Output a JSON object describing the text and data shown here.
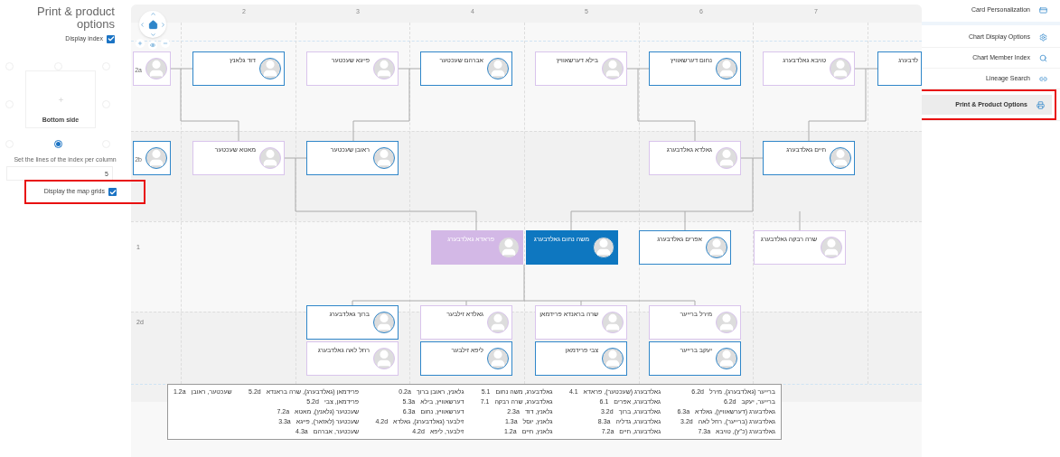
{
  "left_panel": {
    "title": "Print & product options",
    "display_index": {
      "label": "Display index",
      "checked": true
    },
    "positions": [
      {
        "selected": false
      },
      {
        "selected": false
      },
      {
        "selected": false
      },
      {
        "selected": false
      },
      {
        "selected": false
      },
      {
        "selected": false
      },
      {
        "selected": true
      },
      {
        "selected": false
      }
    ],
    "preview": {
      "label": "Bottom side"
    },
    "lines_per_column": {
      "label": "Set the lines of the index per column",
      "value": "5"
    },
    "map_grids": {
      "label": "Display the map grids",
      "checked": true,
      "highlighted": true
    }
  },
  "chart": {
    "column_headers": [
      "7",
      "6",
      "5",
      "4",
      "3",
      "2"
    ],
    "rows": [
      {
        "cards": [
          {
            "name": "לדבערג",
            "color": "#2f86c9",
            "focus": false
          },
          {
            "name": "טויבא גאלדבערג",
            "color": "#d9c4ec",
            "focus": false
          },
          {
            "name": "נחום דערשאוויץ",
            "color": "#2f86c9",
            "focus": false
          },
          {
            "name": "בילא דערשאוויץ",
            "color": "#d9c4ec",
            "focus": false
          },
          {
            "name": "אברהם שעכטער",
            "color": "#2f86c9",
            "focus": false
          },
          {
            "name": "פייגא שעכטער",
            "color": "#d9c4ec",
            "focus": false
          },
          {
            "name": "דוד גלאנץ",
            "color": "#2f86c9",
            "focus": false
          },
          {
            "code": "2a",
            "color": "#d9c4ec",
            "focus": false
          }
        ]
      },
      {
        "cards": [
          {
            "name": "חיים גאלדבערג",
            "color": "#2f86c9",
            "focus": false
          },
          {
            "name": "גאלדא גאלדבערג",
            "color": "#d9c4ec",
            "focus": false
          },
          {
            "name": "ראובן שעכטער",
            "color": "#2f86c9",
            "focus": false
          },
          {
            "name": "מאטא שעכטער",
            "color": "#d9c4ec",
            "focus": false
          },
          {
            "code": "2b",
            "color": "#2f86c9",
            "focus": false
          }
        ]
      },
      {
        "label": "1",
        "cards": [
          {
            "name": "שרה רבקה גאלדבערג",
            "color": "#d9c4ec",
            "focus": false
          },
          {
            "name": "אפרים גאלדבערג",
            "color": "#2f86c9",
            "focus": false
          },
          {
            "name": "משה נחום גאלדבערג",
            "color": "#0e77c0",
            "focus": true
          },
          {
            "name": "פראדא גאלדבערג",
            "color": "#d3b8e6",
            "focus": true
          }
        ]
      },
      {
        "label": "2d",
        "cards": [
          {
            "name": "מירל ברייער",
            "color": "#d9c4ec",
            "focus": false
          },
          {
            "name": "שרה בראנדא פרידמאן",
            "color": "#d9c4ec",
            "focus": false
          },
          {
            "name": "גאלדא זילבער",
            "color": "#d9c4ec",
            "focus": false
          },
          {
            "name": "ברוך גאלדבערג",
            "color": "#2f86c9",
            "focus": false
          }
        ]
      },
      {
        "cards": [
          {
            "name": "יעקב ברייער",
            "color": "#2f86c9",
            "focus": false
          },
          {
            "name": "צבי פרידמאן",
            "color": "#2f86c9",
            "focus": false
          },
          {
            "name": "ליפא זילבער",
            "color": "#2f86c9",
            "focus": false
          },
          {
            "name": "רחל לאה גאלדבערג",
            "color": "#d9c4ec",
            "focus": false
          }
        ]
      }
    ],
    "index": [
      [
        {
          "name": "ברייער (גאלדבערג), מירל",
          "code": "6.2d"
        },
        {
          "name": "ברייער, יעקב",
          "code": "6.2d"
        },
        {
          "name": "גאלדבערג (דערשאוויץ), גאלדא",
          "code": "6.3a"
        },
        {
          "name": "גאלדבערג (ברייער), רחל לאה",
          "code": "3.2d"
        },
        {
          "name": "גאלדבערג (כ\"ץ), טויבא",
          "code": "7.3a"
        }
      ],
      [
        {
          "name": "גאלדבערג (שעכטער), פראדא",
          "code": "4.1"
        },
        {
          "name": "גאלדבערג, אפרים",
          "code": "6.1"
        },
        {
          "name": "גאלדבערג, ברוך",
          "code": "3.2d"
        },
        {
          "name": "גאלדבערג, גדליה",
          "code": "8.3a"
        },
        {
          "name": "גאלדבערג, חיים",
          "code": "7.2a"
        }
      ],
      [
        {
          "name": "גאלדבערג, משה נחום",
          "code": "5.1"
        },
        {
          "name": "גאלדבערג, שרה רבקה",
          "code": "7.1"
        },
        {
          "name": "גלאנץ, דוד",
          "code": "2.3a"
        },
        {
          "name": "גלאנץ, יוסל",
          "code": "1.3a"
        },
        {
          "name": "גלאנץ, חיים",
          "code": "1.2a"
        }
      ],
      [
        {
          "name": "גלאנץ, ראובן ברוך",
          "code": "0.2a"
        },
        {
          "name": "דערשאוויץ, בילא",
          "code": "5.3a"
        },
        {
          "name": "דערשאוויץ, נחום",
          "code": "6.3a"
        },
        {
          "name": "זילבער (גאלדבערג), גאלדא",
          "code": "4.2d"
        },
        {
          "name": "זילבער, ליפא",
          "code": "4.2d"
        }
      ],
      [
        {
          "name": "פרידמאן (גאלדבערג), שרה בראנדא",
          "code": "5.2d"
        },
        {
          "name": "פרידמאן, צבי",
          "code": "5.2d"
        },
        {
          "name": "שעכטער (גלאנץ), מאטא",
          "code": "7.2a"
        },
        {
          "name": "שעכטער (לאזאר), פייגא",
          "code": "3.3a"
        },
        {
          "name": "שעכטער, אברהם",
          "code": "4.3a"
        }
      ],
      [
        {
          "name": "שעכטער, ראובן",
          "code": "1.2a"
        }
      ]
    ]
  },
  "right_menu": [
    {
      "label": "Card Personalization",
      "kind": "card",
      "selected": false,
      "highlighted": false
    },
    {
      "label": "Chart Display Options",
      "kind": "gear",
      "selected": false,
      "highlighted": false
    },
    {
      "label": "Chart Member Index",
      "kind": "search",
      "selected": false,
      "highlighted": false
    },
    {
      "label": "Lineage Search",
      "kind": "link",
      "selected": false,
      "highlighted": false
    },
    {
      "label": "Print & Product Options",
      "kind": "print",
      "selected": true,
      "highlighted": true
    }
  ]
}
